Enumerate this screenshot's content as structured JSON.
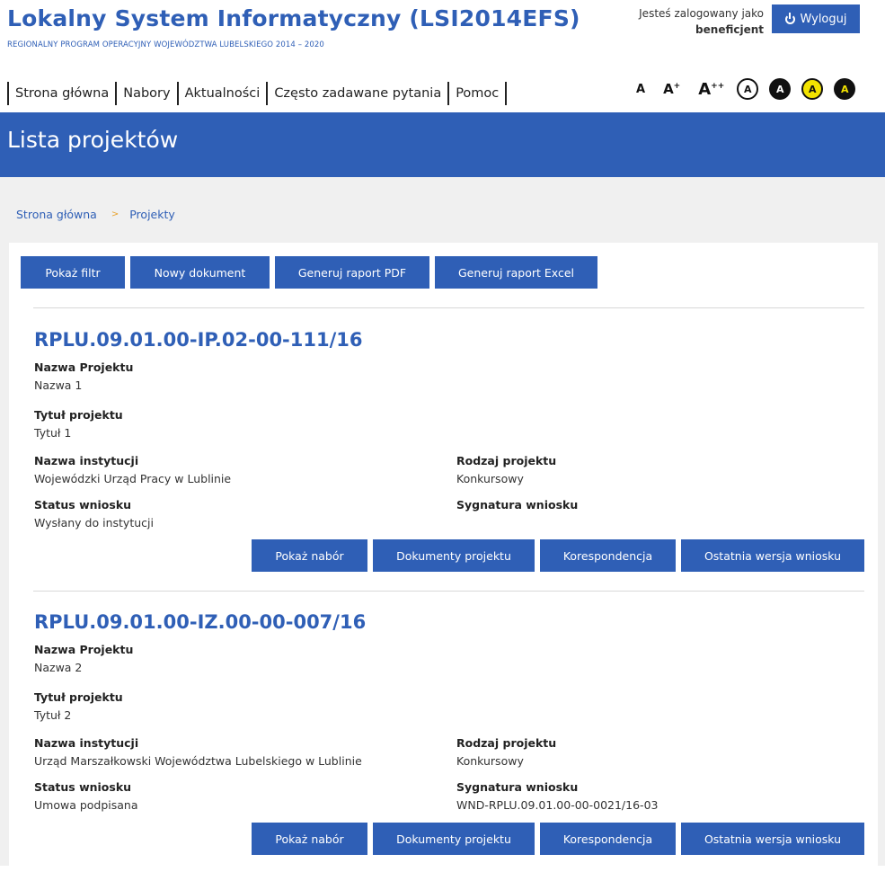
{
  "header": {
    "title": "Lokalny System Informatyczny (LSI2014EFS)",
    "subtitle": "REGIONALNY PROGRAM OPERACYJNY WOJEWÓDZTWA LUBELSKIEGO 2014 – 2020",
    "logged_in_text": "Jesteś zalogowany jako",
    "role": "beneficjent",
    "logout_label": "Wyloguj"
  },
  "nav": {
    "items": [
      "Strona główna",
      "Nabory",
      "Aktualności",
      "Często zadawane pytania",
      "Pomoc"
    ]
  },
  "accessibility": {
    "font_sizes": [
      "A",
      "A+",
      "A++"
    ],
    "contrast_label": "A"
  },
  "page": {
    "title": "Lista projektów"
  },
  "breadcrumb": {
    "home": "Strona główna",
    "separator": ">",
    "current": "Projekty"
  },
  "toolbar": {
    "show_filter": "Pokaż filtr",
    "new_document": "Nowy dokument",
    "report_pdf": "Generuj raport PDF",
    "report_excel": "Generuj raport Excel"
  },
  "labels": {
    "project_name": "Nazwa Projektu",
    "project_title": "Tytuł projektu",
    "institution": "Nazwa instytucji",
    "project_type": "Rodzaj projektu",
    "status": "Status wniosku",
    "signature": "Sygnatura wniosku"
  },
  "actions": {
    "show_call": "Pokaż nabór",
    "documents": "Dokumenty projektu",
    "correspondence": "Korespondencja",
    "latest_version": "Ostatnia wersja wniosku"
  },
  "projects": [
    {
      "number": "RPLU.09.01.00-IP.02-00-111/16",
      "name": "Nazwa 1",
      "title": "Tytuł 1",
      "institution": "Wojewódzki Urząd Pracy w Lublinie",
      "type": "Konkursowy",
      "status": "Wysłany do instytucji",
      "signature": ""
    },
    {
      "number": "RPLU.09.01.00-IZ.00-00-007/16",
      "name": "Nazwa 2",
      "title": "Tytuł 2",
      "institution": "Urząd Marszałkowski Województwa Lubelskiego w Lublinie",
      "type": "Konkursowy",
      "status": "Umowa podpisana",
      "signature": "WND-RPLU.09.01.00-00-0021/16-03"
    }
  ],
  "colors": {
    "brand_blue": "#2f5fb6",
    "breadcrumb_separator": "#e8a32e",
    "background_gray": "#f0f0f0"
  }
}
